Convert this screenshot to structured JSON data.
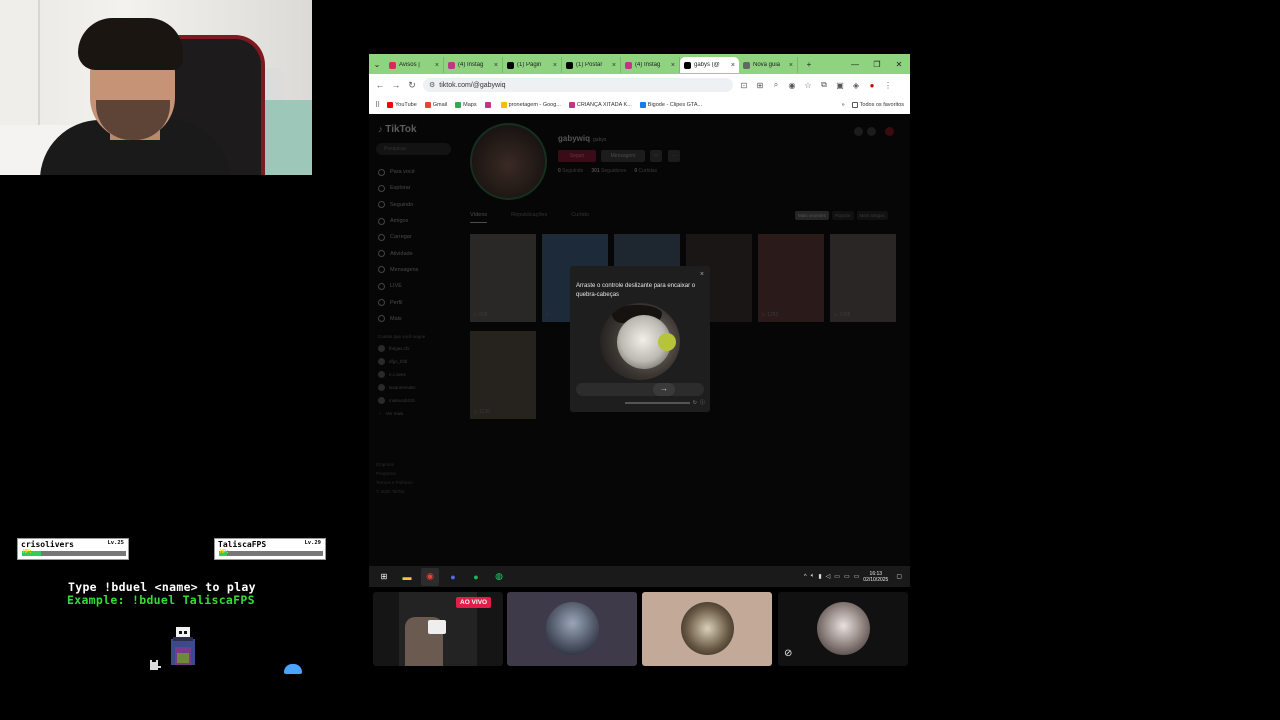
{
  "browser": {
    "tabs": [
      {
        "label": "Avisos |",
        "icon_color": "#e0245e",
        "active": false
      },
      {
        "label": "(4) Instag",
        "icon_color": "#c13584",
        "active": false
      },
      {
        "label": "(1) Págin",
        "icon_color": "#000000",
        "active": false
      },
      {
        "label": "(1) Postar",
        "icon_color": "#000000",
        "active": false
      },
      {
        "label": "(4) Instag",
        "icon_color": "#c13584",
        "active": false
      },
      {
        "label": "gabys (@",
        "icon_color": "#000000",
        "active": true
      },
      {
        "label": "Nova guia",
        "icon_color": "#666666",
        "active": false
      }
    ],
    "url": "tiktok.com/@gabywiq",
    "bookmarks": [
      {
        "label": "YouTube",
        "color": "#ff0000"
      },
      {
        "label": "Gmail",
        "color": "#ea4335"
      },
      {
        "label": "Maps",
        "color": "#34a853"
      },
      {
        "label": "",
        "color": "#c13584"
      },
      {
        "label": "pronetagem - Goog...",
        "color": "#fbbc05"
      },
      {
        "label": "CRIANÇA XITADA K...",
        "color": "#c13584"
      },
      {
        "label": "Bigode - Clipes GTA...",
        "color": "#1877f2"
      }
    ],
    "all_bookmarks_label": "Todos os favoritos"
  },
  "tiktok": {
    "logo": "TikTok",
    "search_placeholder": "Pesquisar",
    "nav": [
      "Para você",
      "Explorar",
      "Seguindo",
      "Amigos",
      "Carregar",
      "Atividade",
      "Mensagens",
      "LIVE",
      "Perfil",
      "Mais"
    ],
    "following_title": "Contas que você segue",
    "following": [
      "fbrigas.cfx",
      "dfgs_bfdl",
      "e.c.aves",
      "lasanmendec",
      "mateusi2415"
    ],
    "see_more": "Ver mais",
    "footer": [
      "Empresa",
      "Programa",
      "Termos e Políticas",
      "© 2025 TikTok"
    ],
    "username": "gabywiq",
    "display_name": "gabys",
    "follow_btn": "Seguir",
    "message_btn": "Mensagem",
    "stats": {
      "following": "0",
      "following_label": "Seguindo",
      "followers": "301",
      "followers_label": "Seguidores",
      "likes": "0",
      "likes_label": "Curtidas"
    },
    "tabs": [
      "Vídeos",
      "Republicações",
      "Curtido"
    ],
    "sort": [
      "Mais recentes",
      "Popular",
      "Mais antigos"
    ],
    "thumb_views": [
      "898",
      "",
      "",
      "",
      "1253",
      "1068",
      "1130"
    ]
  },
  "captcha": {
    "title": "Arraste o controle deslizante para encaixar o quebra-cabeças",
    "close": "×",
    "slider_arrow": "→",
    "refresh_icon": "↻",
    "info_icon": "ⓘ"
  },
  "taskbar": {
    "time": "16:13",
    "date": "02/10/2025"
  },
  "call": {
    "live_badge": "AO VIVO"
  },
  "game": {
    "players": [
      {
        "name": "crisolivers",
        "level": "Lv.25",
        "hp_label": "HP:",
        "hp": 0.18
      },
      {
        "name": "TaliscaFPS",
        "level": "Lv.29",
        "hp_label": "HP:",
        "hp": 0.08
      }
    ],
    "instruction": "Type !bduel <name> to play",
    "example": "Example: !bduel TaliscaFPS",
    "instruction_color": "#ffffff",
    "example_color": "#33dd33"
  }
}
